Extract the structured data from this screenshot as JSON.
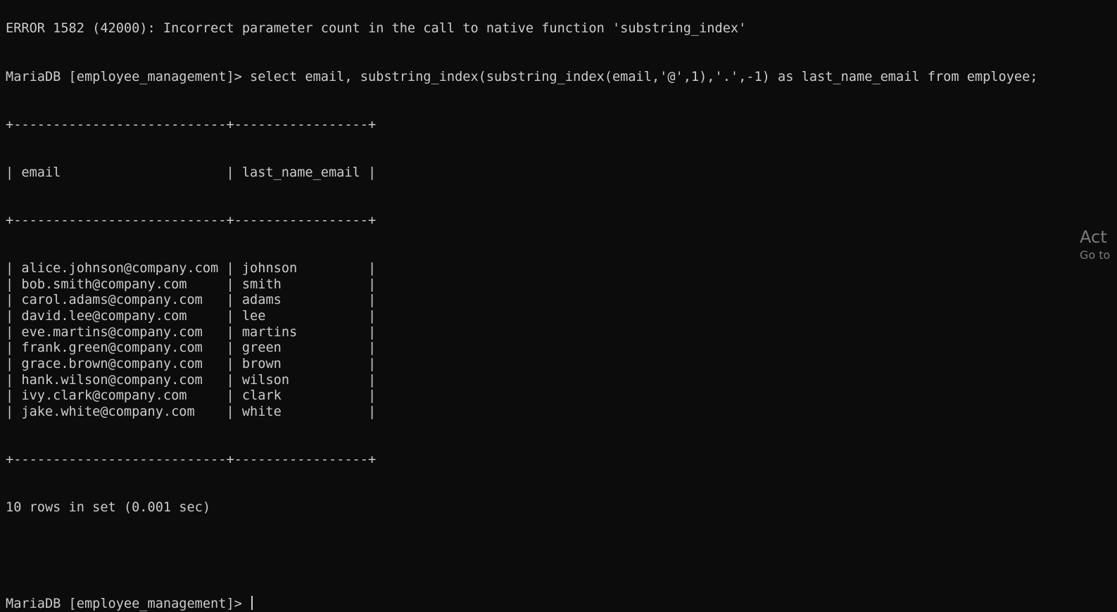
{
  "terminal": {
    "warning_line": "ERROR 1582 (42000): Incorrect parameter count in the call to native function 'substring_index'",
    "prompt": "MariaDB [employee_management]> ",
    "query": "select email, substring_index(substring_index(email,'@',1),'.',-1) as last_name_email from employee;",
    "border_line": "+---------------------------+-----------------+",
    "header_row": "| email                     | last_name_email |",
    "columns": [
      "email",
      "last_name_email"
    ],
    "rows": [
      {
        "email": "alice.johnson@company.com",
        "last_name_email": "johnson"
      },
      {
        "email": "bob.smith@company.com",
        "last_name_email": "smith"
      },
      {
        "email": "carol.adams@company.com",
        "last_name_email": "adams"
      },
      {
        "email": "david.lee@company.com",
        "last_name_email": "lee"
      },
      {
        "email": "eve.martins@company.com",
        "last_name_email": "martins"
      },
      {
        "email": "frank.green@company.com",
        "last_name_email": "green"
      },
      {
        "email": "grace.brown@company.com",
        "last_name_email": "brown"
      },
      {
        "email": "hank.wilson@company.com",
        "last_name_email": "wilson"
      },
      {
        "email": "ivy.clark@company.com",
        "last_name_email": "clark"
      },
      {
        "email": "jake.white@company.com",
        "last_name_email": "white"
      }
    ],
    "summary": "10 rows in set (0.001 sec)",
    "final_prompt": "MariaDB [employee_management]> "
  },
  "watermark": {
    "title": "Act",
    "subtitle": "Go to"
  },
  "colors": {
    "background": "#0c0c0c",
    "text": "#cccccc",
    "watermark": "#7a7a7a"
  }
}
